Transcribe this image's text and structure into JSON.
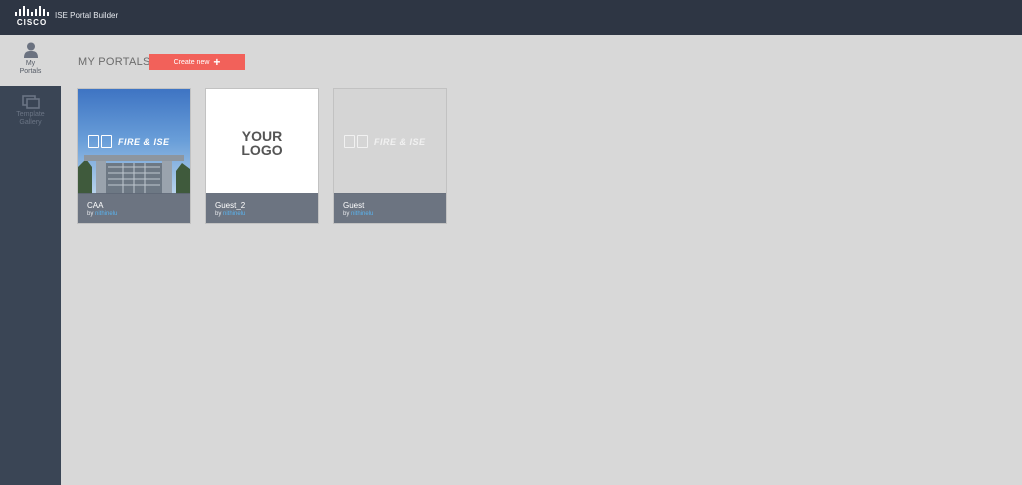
{
  "header": {
    "logo_word": "CISCO",
    "app_title": "ISE Portal Builder"
  },
  "sidebar": {
    "items": [
      {
        "label": "My\nPortals",
        "icon": "user-icon",
        "active": true
      },
      {
        "label": "Template\nGallery",
        "icon": "gallery-icon",
        "active": false
      }
    ]
  },
  "main": {
    "heading": "MY PORTALS",
    "create_button": {
      "label": "Create new",
      "icon": "plus-icon"
    }
  },
  "portals": [
    {
      "name": "CAA",
      "by_prefix": "by",
      "author": "nithinelu",
      "thumbnail": "photo",
      "brand_text": "FIRE & ISE"
    },
    {
      "name": "Guest_2",
      "by_prefix": "by",
      "author": "nithinelu",
      "thumbnail": "your-logo",
      "logo_text": "YOUR\nLOGO"
    },
    {
      "name": "Guest",
      "by_prefix": "by",
      "author": "nithinelu",
      "thumbnail": "plain",
      "brand_text": "FIRE & ISE"
    }
  ],
  "colors": {
    "topbar": "#2e3644",
    "sidebar": "#3a4555",
    "content_bg": "#d8d8d8",
    "accent_button": "#f2615a",
    "author_link": "#5ab3ee"
  }
}
